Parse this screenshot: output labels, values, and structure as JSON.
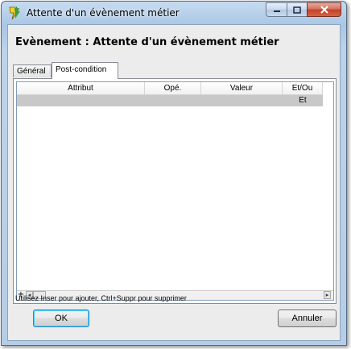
{
  "window": {
    "title": "Attente d'un évènement métier",
    "icon": "app-logo-icon"
  },
  "caption": {
    "minimize": "minimize-icon",
    "maximize": "maximize-icon",
    "close": "close-icon"
  },
  "heading": "Evènement : Attente d'un évènement métier",
  "tabs": [
    {
      "label": "Général",
      "active": false
    },
    {
      "label": "Post-condition",
      "active": true
    }
  ],
  "grid": {
    "columns": [
      "Attribut",
      "Opé.",
      "Valeur",
      "Et/Ou"
    ],
    "rows": [
      {
        "attribut": "",
        "ope": "",
        "valeur": "",
        "etou": "Et"
      }
    ]
  },
  "scroll": {
    "plus": "+",
    "left": "◂",
    "right": "▸"
  },
  "hint": "Utilisez Inser pour ajouter, Ctrl+Suppr pour supprimer",
  "buttons": {
    "ok": "OK",
    "cancel": "Annuler"
  },
  "colors": {
    "selected_row": "#c8c8c8",
    "close_button": "#c2412a",
    "title_gradient": "#a9c6e4"
  }
}
